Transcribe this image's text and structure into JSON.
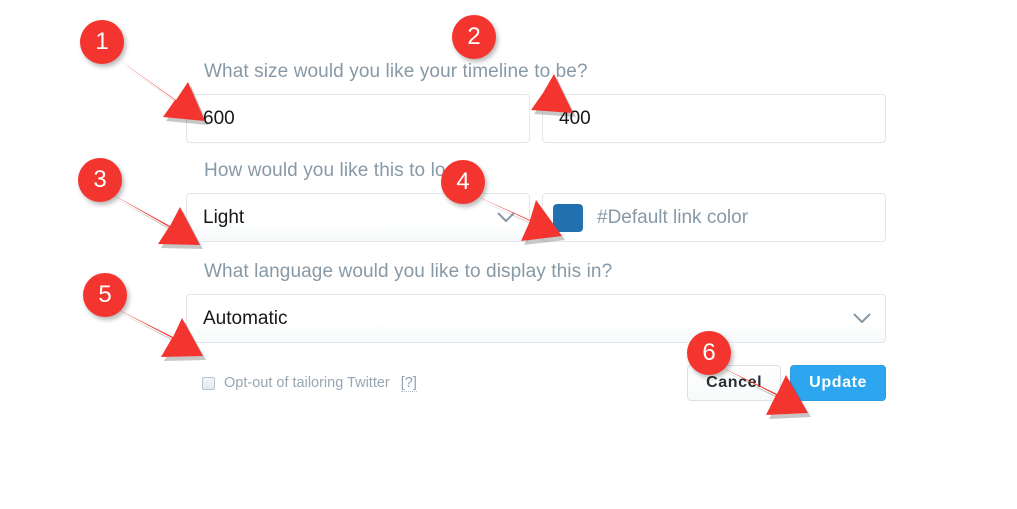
{
  "form": {
    "size_question": "What size would you like your timeline to be?",
    "width_value": "600",
    "height_value": "400",
    "look_question": "How would you like this to look?",
    "theme_value": "Light",
    "color_placeholder": "#Default link color",
    "color_swatch_hex": "#2270ad",
    "language_question": "What language would you like to display this in?",
    "language_value": "Automatic"
  },
  "footer": {
    "optout_label": "Opt-out of tailoring Twitter",
    "help_label": "[?]",
    "cancel_label": "Cancel",
    "update_label": "Update",
    "update_color": "#2ca7ef"
  },
  "annotations": {
    "color": "#f4352f",
    "items": [
      {
        "number": "1"
      },
      {
        "number": "2"
      },
      {
        "number": "3"
      },
      {
        "number": "4"
      },
      {
        "number": "5"
      },
      {
        "number": "6"
      }
    ]
  }
}
